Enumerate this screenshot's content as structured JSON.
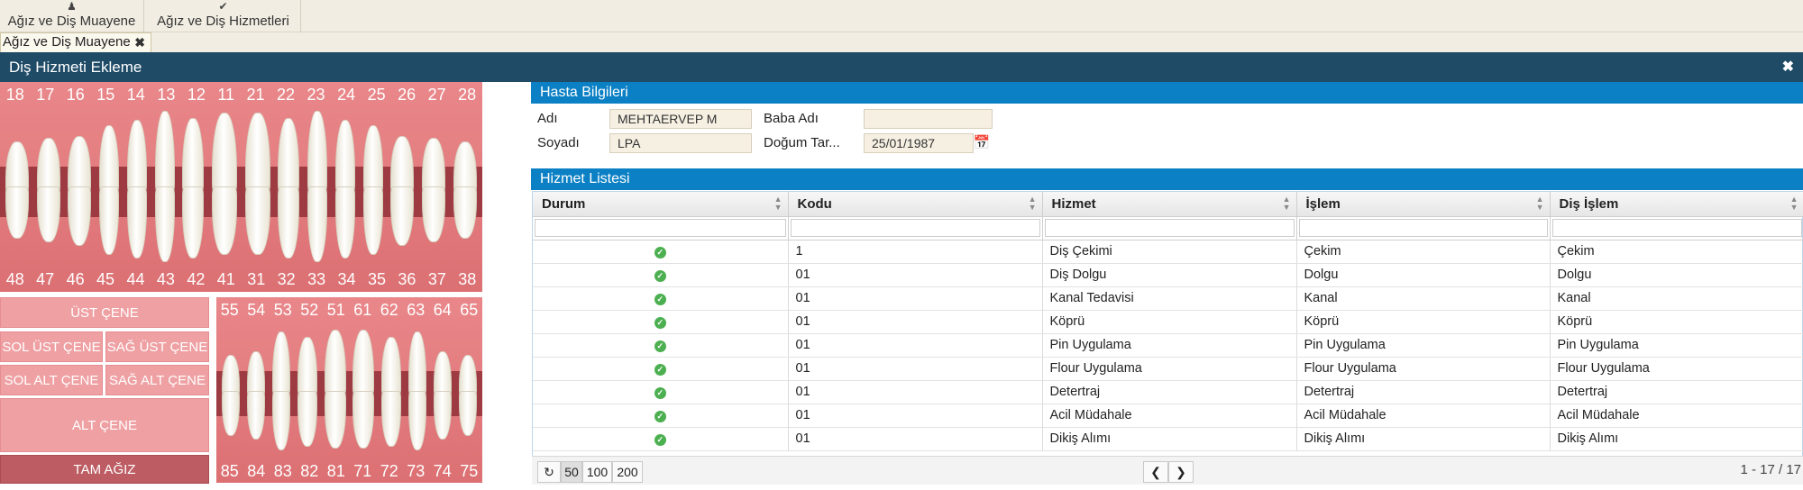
{
  "toolbar": {
    "buttons": [
      {
        "label": "Ağız ve Diş Muayene",
        "icon": "user-tooth-icon"
      },
      {
        "label": "Ağız ve Diş Hizmetleri",
        "icon": "check-icon"
      }
    ]
  },
  "tabs": [
    {
      "label": "Ağız ve Diş Muayene"
    }
  ],
  "dialog": {
    "title": "Diş Hizmeti Ekleme"
  },
  "teeth": {
    "upper_numbers": [
      "18",
      "17",
      "16",
      "15",
      "14",
      "13",
      "12",
      "11",
      "21",
      "22",
      "23",
      "24",
      "25",
      "26",
      "27",
      "28"
    ],
    "lower_numbers": [
      "48",
      "47",
      "46",
      "45",
      "44",
      "43",
      "42",
      "41",
      "31",
      "32",
      "33",
      "34",
      "35",
      "36",
      "37",
      "38"
    ],
    "child_upper_numbers": [
      "55",
      "54",
      "53",
      "52",
      "51",
      "61",
      "62",
      "63",
      "64",
      "65"
    ],
    "child_lower_numbers": [
      "85",
      "84",
      "83",
      "82",
      "81",
      "71",
      "72",
      "73",
      "74",
      "75"
    ]
  },
  "jaw_buttons": {
    "ust_cene": "ÜST ÇENE",
    "sol_ust": "SOL ÜST ÇENE",
    "sag_ust": "SAĞ ÜST ÇENE",
    "sol_alt": "SOL ALT ÇENE",
    "sag_alt": "SAĞ ALT ÇENE",
    "alt_cene": "ALT ÇENE",
    "tam_agiz": "TAM AĞIZ"
  },
  "patient": {
    "section_title": "Hasta Bilgileri",
    "adi_label": "Adı",
    "adi_value": "MEHTAERVEP M",
    "soyadi_label": "Soyadı",
    "soyadi_value": "LPA",
    "baba_label": "Baba Adı",
    "baba_value": "",
    "dogum_label": "Doğum Tar...",
    "dogum_value": "25/01/1987"
  },
  "services": {
    "section_title": "Hizmet Listesi",
    "columns": [
      "Durum",
      "Kodu",
      "Hizmet",
      "İşlem",
      "Diş İşlem"
    ],
    "rows": [
      {
        "kodu": "1",
        "hizmet": "Diş Çekimi",
        "islem": "Çekim",
        "dis_islem": "Çekim"
      },
      {
        "kodu": "01",
        "hizmet": "Diş Dolgu",
        "islem": "Dolgu",
        "dis_islem": "Dolgu"
      },
      {
        "kodu": "01",
        "hizmet": "Kanal Tedavisi",
        "islem": "Kanal",
        "dis_islem": "Kanal"
      },
      {
        "kodu": "01",
        "hizmet": "Köprü",
        "islem": "Köprü",
        "dis_islem": "Köprü"
      },
      {
        "kodu": "01",
        "hizmet": "Pin Uygulama",
        "islem": "Pin Uygulama",
        "dis_islem": "Pin Uygulama"
      },
      {
        "kodu": "01",
        "hizmet": "Flour Uygulama",
        "islem": "Flour Uygulama",
        "dis_islem": "Flour Uygulama"
      },
      {
        "kodu": "01",
        "hizmet": "Detertraj",
        "islem": "Detertraj",
        "dis_islem": "Detertraj"
      },
      {
        "kodu": "01",
        "hizmet": "Acil Müdahale",
        "islem": "Acil Müdahale",
        "dis_islem": "Acil Müdahale"
      },
      {
        "kodu": "01",
        "hizmet": "Dikiş Alımı",
        "islem": "Dikiş Alımı",
        "dis_islem": "Dikiş Alımı"
      }
    ]
  },
  "pager": {
    "sizes": [
      "50",
      "100",
      "200"
    ],
    "selected": "50",
    "info": "1 - 17 / 17"
  },
  "colors": {
    "header_dark": "#1f4b67",
    "section_blue": "#0c80c4",
    "gum_pink": "#e27a7e",
    "status_ok": "#4caf50"
  }
}
